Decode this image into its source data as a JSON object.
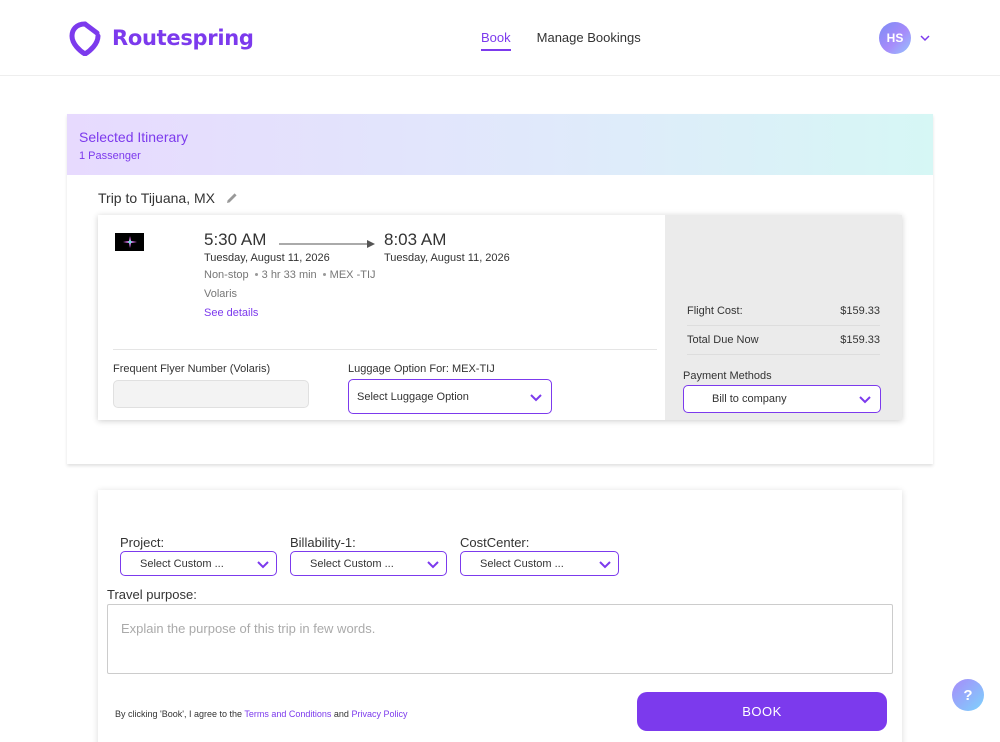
{
  "brand": {
    "name": "Routespring",
    "accent": "#7c3aed"
  },
  "nav": {
    "items": [
      {
        "label": "Book",
        "active": true
      },
      {
        "label": "Manage Bookings",
        "active": false
      }
    ]
  },
  "user": {
    "initials": "HS"
  },
  "itinerary": {
    "title": "Selected Itinerary",
    "passengers": "1 Passenger",
    "trip_title": "Trip to Tijuana, MX",
    "flight": {
      "depart_time": "5:30 AM",
      "depart_date": "Tuesday, August 11, 2026",
      "arrive_time": "8:03 AM",
      "arrive_date": "Tuesday, August 11, 2026",
      "stops": "Non-stop",
      "duration": "3 hr 33 min",
      "route": "MEX -TIJ",
      "airline": "Volaris",
      "see_details": "See details"
    },
    "frequent_flyer": {
      "label": "Frequent Flyer Number (Volaris)",
      "value": ""
    },
    "luggage": {
      "label": "Luggage Option For: MEX-TIJ",
      "value": "Select Luggage Option"
    },
    "pricing": {
      "flight_cost_label": "Flight Cost:",
      "flight_cost": "$159.33",
      "total_due_label": "Total Due Now",
      "total_due": "$159.33"
    },
    "payment": {
      "label": "Payment Methods",
      "value": "Bill to company"
    }
  },
  "custom_fields": [
    {
      "label": "Project:",
      "value": "Select Custom ..."
    },
    {
      "label": "Billability-1:",
      "value": "Select Custom ..."
    },
    {
      "label": "CostCenter:",
      "value": "Select Custom ..."
    }
  ],
  "travel_purpose": {
    "label": "Travel purpose:",
    "placeholder": "Explain the purpose of this trip in few words."
  },
  "terms": {
    "prefix": "By clicking 'Book', I agree to the",
    "terms_link": "Terms and Conditions",
    "and": "and",
    "privacy_link": "Privacy Policy"
  },
  "book_button": "BOOK",
  "help": "?",
  "icons": [
    "routespring-logo-icon",
    "chevron-down-icon",
    "pencil-icon",
    "arrow-right-icon",
    "airline-logo-icon",
    "help-icon"
  ]
}
